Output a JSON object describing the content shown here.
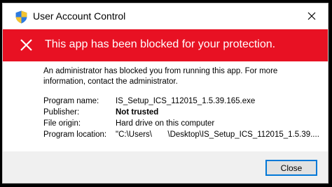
{
  "window": {
    "title": "User Account Control",
    "icon": "uac-shield-icon",
    "close_icon": "close-icon"
  },
  "banner": {
    "icon": "blocked-x-icon",
    "text": "This app has been blocked for your protection.",
    "color": "#e81123"
  },
  "message": "An administrator has blocked you from running this app. For more information, contact the administrator.",
  "details": [
    {
      "label": "Program name:",
      "value": "IS_Setup_ICS_112015_1.5.39.165.exe"
    },
    {
      "label": "Publisher:",
      "value": "Not trusted"
    },
    {
      "label": "File origin:",
      "value": "Hard drive on this computer"
    },
    {
      "label": "Program location:",
      "value": "\"C:\\Users\\       \\Desktop\\IS_Setup_ICS_112015_1.5.39...."
    }
  ],
  "footer": {
    "close_label": "Close",
    "accent": "#0078d7"
  }
}
